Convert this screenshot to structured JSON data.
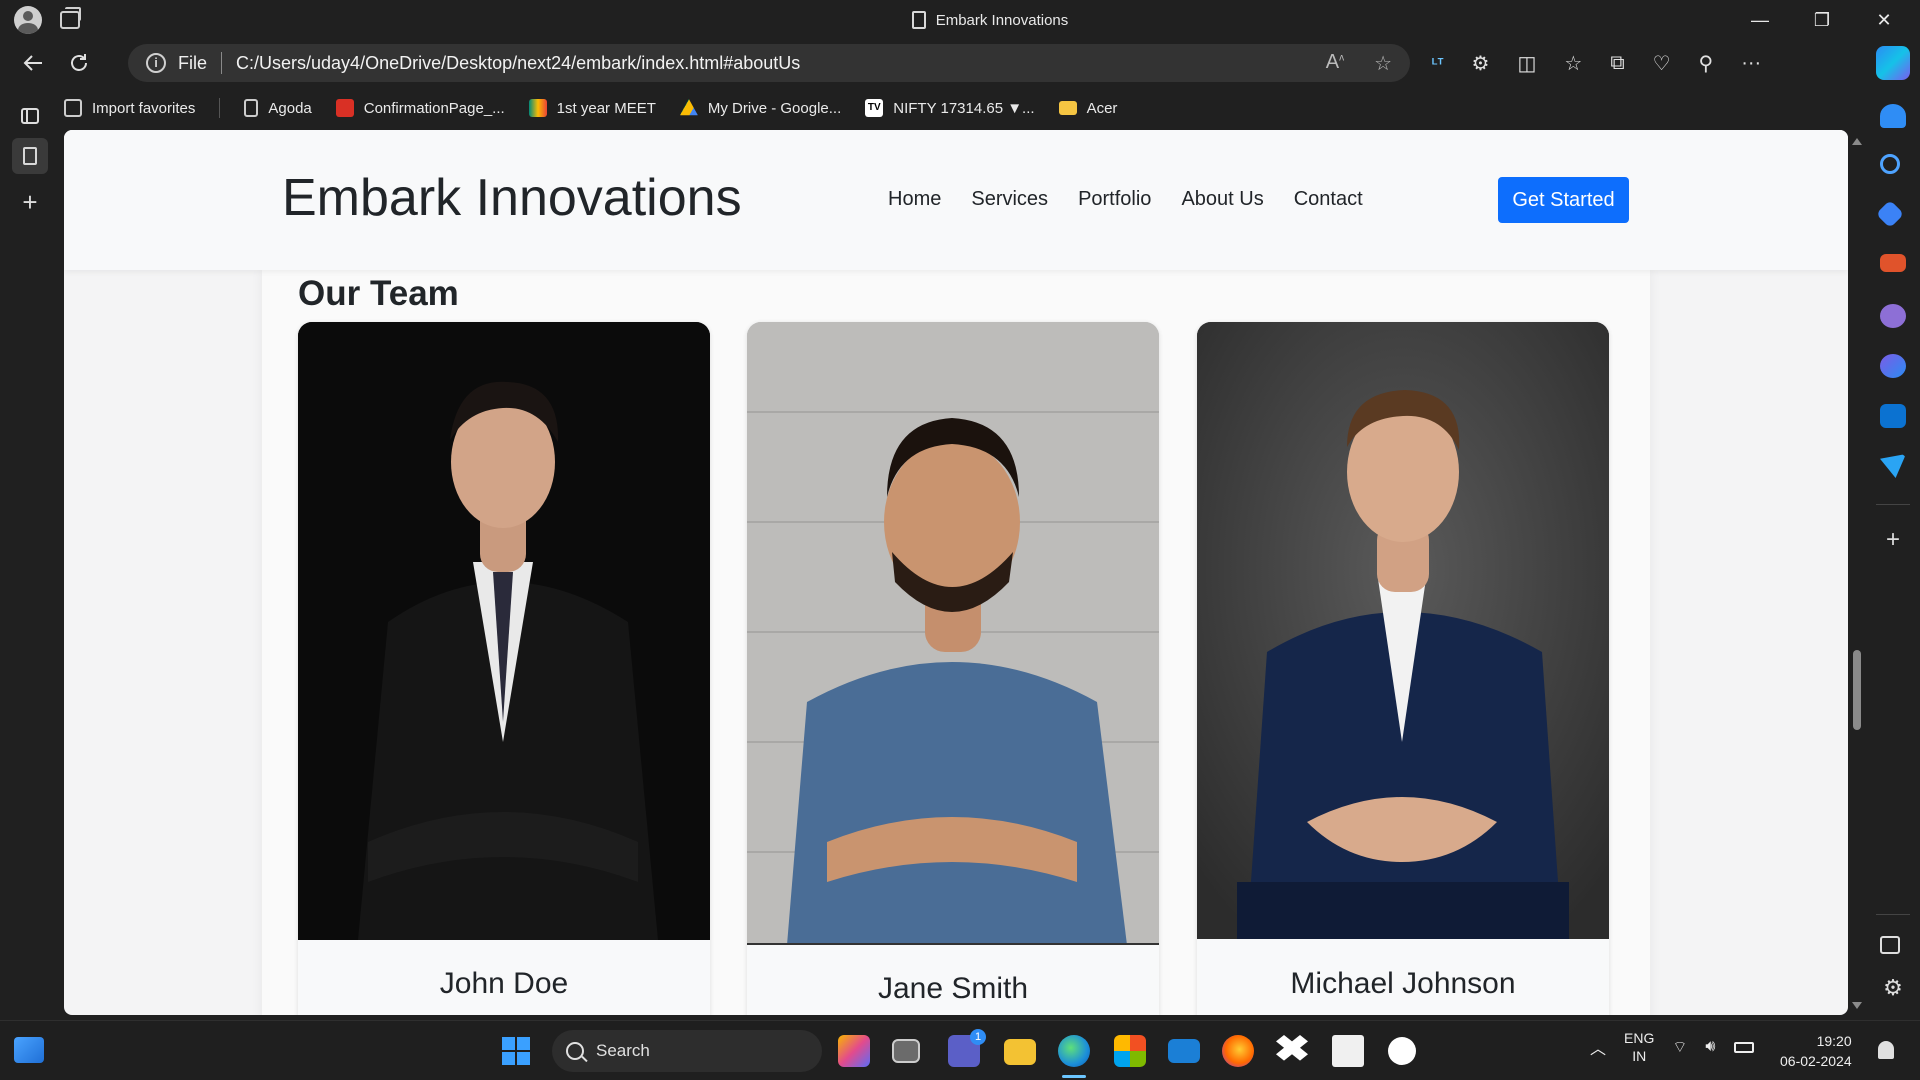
{
  "window": {
    "title": "Embark Innovations",
    "controls": {
      "minimize": "—",
      "restore": "❐",
      "close": "✕"
    }
  },
  "address_bar": {
    "scheme": "File",
    "url": "C:/Users/uday4/OneDrive/Desktop/next24/embark/index.html#aboutUs"
  },
  "favorites": [
    {
      "label": "Import favorites",
      "icon": "import-icon",
      "color": "#cccccc"
    },
    {
      "label": "Agoda",
      "icon": "page-icon",
      "color": "#cccccc"
    },
    {
      "label": "ConfirmationPage_...",
      "icon": "pdf-icon",
      "color": "#d93025"
    },
    {
      "label": "1st year MEET",
      "icon": "meet-icon",
      "color": "#00897b"
    },
    {
      "label": "My Drive - Google...",
      "icon": "drive-icon",
      "color": "#fbbc04"
    },
    {
      "label": "NIFTY 17314.65 ▼...",
      "icon": "tradingview-icon",
      "color": "#ffffff"
    },
    {
      "label": "Acer",
      "icon": "folder-icon",
      "color": "#f5c542"
    }
  ],
  "site": {
    "brand": "Embark Innovations",
    "nav": [
      "Home",
      "Services",
      "Portfolio",
      "About Us",
      "Contact"
    ],
    "cta": "Get Started",
    "accent": "#0d6efd",
    "team_title": "Our Team",
    "team": [
      {
        "name": "John Doe"
      },
      {
        "name": "Jane Smith"
      },
      {
        "name": "Michael Johnson"
      }
    ]
  },
  "taskbar": {
    "search_placeholder": "Search",
    "tray": {
      "lang_line1": "ENG",
      "lang_line2": "IN"
    },
    "clock": {
      "time": "19:20",
      "date": "06-02-2024"
    },
    "teams_badge": "1"
  }
}
